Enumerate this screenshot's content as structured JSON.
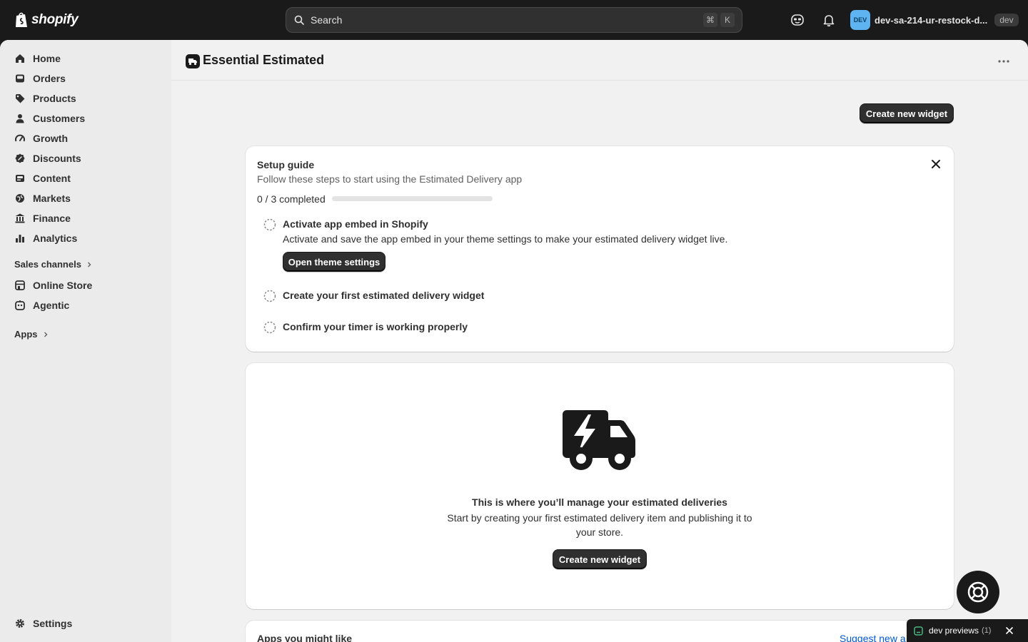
{
  "topbar": {
    "logo_text": "shopify",
    "search_placeholder": "Search",
    "shortcut_mod": "⌘",
    "shortcut_key": "K",
    "avatar_initials": "DEV",
    "store_name": "dev-sa-214-ur-restock-d...",
    "env_badge": "dev"
  },
  "sidebar": {
    "items": [
      {
        "label": "Home",
        "icon": "home-icon"
      },
      {
        "label": "Orders",
        "icon": "inbox-icon"
      },
      {
        "label": "Products",
        "icon": "tag-icon"
      },
      {
        "label": "Customers",
        "icon": "person-icon"
      },
      {
        "label": "Growth",
        "icon": "gauge-icon"
      },
      {
        "label": "Discounts",
        "icon": "discount-icon"
      },
      {
        "label": "Content",
        "icon": "image-icon"
      },
      {
        "label": "Markets",
        "icon": "globe-icon"
      },
      {
        "label": "Finance",
        "icon": "bank-icon"
      },
      {
        "label": "Analytics",
        "icon": "bar-chart-icon"
      }
    ],
    "sales_channels_label": "Sales channels",
    "channels": [
      {
        "label": "Online Store",
        "icon": "store-icon"
      },
      {
        "label": "Agentic",
        "icon": "bot-icon"
      }
    ],
    "apps_label": "Apps",
    "settings_label": "Settings"
  },
  "app": {
    "title": "Essential Estimated",
    "create_widget_label": "Create new widget"
  },
  "setup_guide": {
    "title": "Setup guide",
    "subtitle": "Follow these steps to start using the Estimated Delivery app",
    "progress_text": "0 / 3 completed",
    "progress_fraction": 0,
    "steps": [
      {
        "title": "Activate app embed in Shopify",
        "description": "Activate and save the app embed in your theme settings to make your estimated delivery widget live.",
        "button": "Open theme settings"
      },
      {
        "title": "Create your first estimated delivery widget"
      },
      {
        "title": "Confirm your timer is working properly"
      }
    ]
  },
  "empty_state": {
    "title": "This is where you’ll manage your estimated deliveries",
    "description": "Start by creating your first estimated delivery item and publishing it to your store.",
    "button": "Create new widget"
  },
  "apps_section": {
    "title": "Apps you might like",
    "link": "Suggest new a"
  },
  "dev_previews": {
    "label": "dev previews",
    "count": "(1)"
  },
  "colors": {
    "topbar_bg": "#1a1a1a",
    "frame_bg": "#ebebeb",
    "main_bg": "#f1f1f1",
    "primary_button": "#303030",
    "link": "#005bd3",
    "avatar": "#5db4f0"
  }
}
